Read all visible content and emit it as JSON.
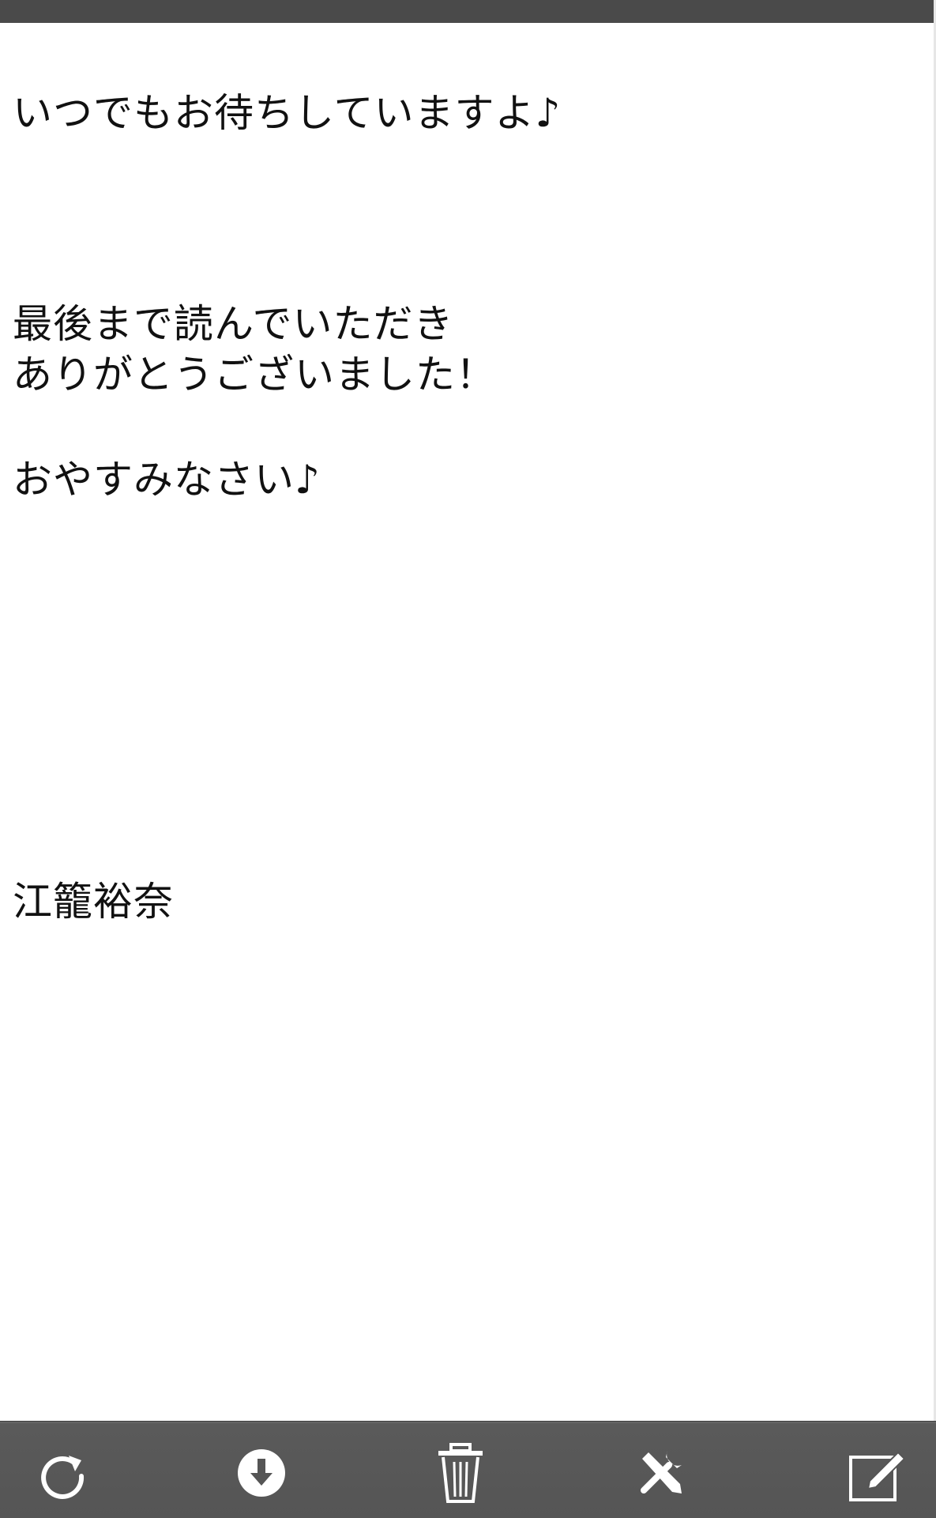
{
  "note": {
    "lines": {
      "l1": "いつでもお待ちしていますよ♪",
      "l2": "最後まで読んでいただき",
      "l3": "ありがとうございました！",
      "l4": "おやすみなさい♪",
      "l5": "江籠裕奈"
    }
  },
  "toolbar": {
    "icons": [
      "refresh-icon",
      "download-icon",
      "trash-icon",
      "tools-icon",
      "compose-icon"
    ],
    "icon_color": "#ffffff",
    "background": "#555555"
  }
}
